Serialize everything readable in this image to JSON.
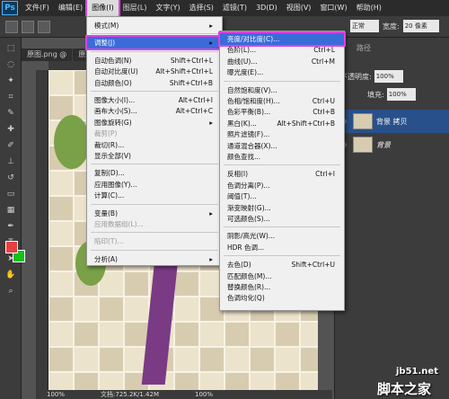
{
  "app": {
    "logo": "Ps"
  },
  "menubar": {
    "items": [
      "文件(F)",
      "编辑(E)",
      "图像(I)",
      "图层(L)",
      "文字(Y)",
      "选择(S)",
      "滤镜(T)",
      "3D(D)",
      "视图(V)",
      "窗口(W)",
      "帮助(H)"
    ]
  },
  "options": {
    "mode_value": "正常",
    "width_label": "宽度:",
    "width_value": "20 像素"
  },
  "doc_tabs": [
    "原图.png @",
    "原图.png @"
  ],
  "image_menu": [
    {
      "label": "模式(M)",
      "shortcut": "",
      "arrow": true
    },
    {
      "sep": true
    },
    {
      "label": "调整(J)",
      "shortcut": "",
      "arrow": true,
      "highlight": true
    },
    {
      "sep": true
    },
    {
      "label": "自动色调(N)",
      "shortcut": "Shift+Ctrl+L"
    },
    {
      "label": "自动对比度(U)",
      "shortcut": "Alt+Shift+Ctrl+L"
    },
    {
      "label": "自动颜色(O)",
      "shortcut": "Shift+Ctrl+B"
    },
    {
      "sep": true
    },
    {
      "label": "图像大小(I)...",
      "shortcut": "Alt+Ctrl+I"
    },
    {
      "label": "画布大小(S)...",
      "shortcut": "Alt+Ctrl+C"
    },
    {
      "label": "图像旋转(G)",
      "shortcut": "",
      "arrow": true
    },
    {
      "label": "裁剪(P)",
      "shortcut": "",
      "disabled": true
    },
    {
      "label": "裁切(R)...",
      "shortcut": ""
    },
    {
      "label": "显示全部(V)",
      "shortcut": ""
    },
    {
      "sep": true
    },
    {
      "label": "复制(D)...",
      "shortcut": ""
    },
    {
      "label": "应用图像(Y)...",
      "shortcut": ""
    },
    {
      "label": "计算(C)...",
      "shortcut": ""
    },
    {
      "sep": true
    },
    {
      "label": "变量(B)",
      "shortcut": "",
      "arrow": true
    },
    {
      "label": "应用数据组(L)...",
      "shortcut": "",
      "disabled": true
    },
    {
      "sep": true
    },
    {
      "label": "陷印(T)...",
      "shortcut": "",
      "disabled": true
    },
    {
      "sep": true
    },
    {
      "label": "分析(A)",
      "shortcut": "",
      "arrow": true
    }
  ],
  "adjust_menu": [
    {
      "label": "亮度/对比度(C)...",
      "shortcut": "",
      "highlight": true
    },
    {
      "label": "色阶(L)...",
      "shortcut": "Ctrl+L"
    },
    {
      "label": "曲线(U)...",
      "shortcut": "Ctrl+M"
    },
    {
      "label": "曝光度(E)...",
      "shortcut": ""
    },
    {
      "sep": true
    },
    {
      "label": "自然饱和度(V)...",
      "shortcut": ""
    },
    {
      "label": "色相/饱和度(H)...",
      "shortcut": "Ctrl+U"
    },
    {
      "label": "色彩平衡(B)...",
      "shortcut": "Ctrl+B"
    },
    {
      "label": "黑白(K)...",
      "shortcut": "Alt+Shift+Ctrl+B"
    },
    {
      "label": "照片滤镜(F)...",
      "shortcut": ""
    },
    {
      "label": "通道混合器(X)...",
      "shortcut": ""
    },
    {
      "label": "颜色查找...",
      "shortcut": ""
    },
    {
      "sep": true
    },
    {
      "label": "反相(I)",
      "shortcut": "Ctrl+I"
    },
    {
      "label": "色调分离(P)...",
      "shortcut": ""
    },
    {
      "label": "阈值(T)...",
      "shortcut": ""
    },
    {
      "label": "渐变映射(G)...",
      "shortcut": ""
    },
    {
      "label": "可选颜色(S)...",
      "shortcut": ""
    },
    {
      "sep": true
    },
    {
      "label": "阴影/高光(W)...",
      "shortcut": ""
    },
    {
      "label": "HDR 色调...",
      "shortcut": ""
    },
    {
      "sep": true
    },
    {
      "label": "去色(D)",
      "shortcut": "Shift+Ctrl+U"
    },
    {
      "label": "匹配颜色(M)...",
      "shortcut": ""
    },
    {
      "label": "替换颜色(R)...",
      "shortcut": ""
    },
    {
      "label": "色调均化(Q)",
      "shortcut": ""
    }
  ],
  "panels": {
    "paths_tab": "路径",
    "opacity_label": "不透明度:",
    "opacity_value": "100%",
    "fill_label": "填充:",
    "fill_value": "100%",
    "layers": [
      {
        "name": "背景 拷贝",
        "selected": true
      },
      {
        "name": "背景",
        "selected": false
      }
    ]
  },
  "status": {
    "zoom": "100%",
    "doc_info": "文档:725.2K/1.42M",
    "zoom2": "100%"
  },
  "watermark": {
    "line1": "jb51.net",
    "line2": "脚本之家"
  },
  "colors": {
    "highlight": "#3a6cd9",
    "annotation": "#e040e0",
    "fg": "#e74040",
    "bg": "#18c018"
  }
}
